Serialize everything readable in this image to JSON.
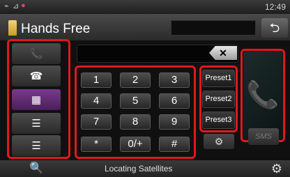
{
  "status_bar": {
    "icons": [
      "satellite-icon",
      "signal-icon",
      "dot-icon"
    ],
    "time": "12:49"
  },
  "header": {
    "title": "Hands Free",
    "back_icon": "back-arrow-icon",
    "back_symbol": "⮌"
  },
  "sidebar": {
    "items": [
      {
        "name": "call-history-button",
        "icon": "call-log-icon",
        "symbol": "📞"
      },
      {
        "name": "outgoing-calls-button",
        "icon": "outgoing-call-icon",
        "symbol": "☎"
      },
      {
        "name": "dialpad-button",
        "icon": "dialpad-icon",
        "symbol": "▦"
      },
      {
        "name": "phonebook-button",
        "icon": "phonebook-icon",
        "symbol": "☰"
      },
      {
        "name": "messages-button",
        "icon": "message-icon",
        "symbol": "☰"
      }
    ]
  },
  "dialer": {
    "display_value": "",
    "clear_symbol": "✕",
    "keys": [
      "1",
      "2",
      "3",
      "4",
      "5",
      "6",
      "7",
      "8",
      "9",
      "*",
      "0/+",
      "#"
    ]
  },
  "presets": [
    "Preset1",
    "Preset2",
    "Preset3"
  ],
  "call_button": {
    "symbol": "📞",
    "icon": "call-icon"
  },
  "sms_label": "SMS",
  "settings_small_symbol": "⚙",
  "bottom_bar": {
    "left_symbol": "🔍",
    "status": "Locating Satellites",
    "right_symbol": "⚙"
  },
  "colors": {
    "highlight": "#e0181e",
    "accent_call": "#1fa862",
    "active": "#7a3a8c"
  }
}
